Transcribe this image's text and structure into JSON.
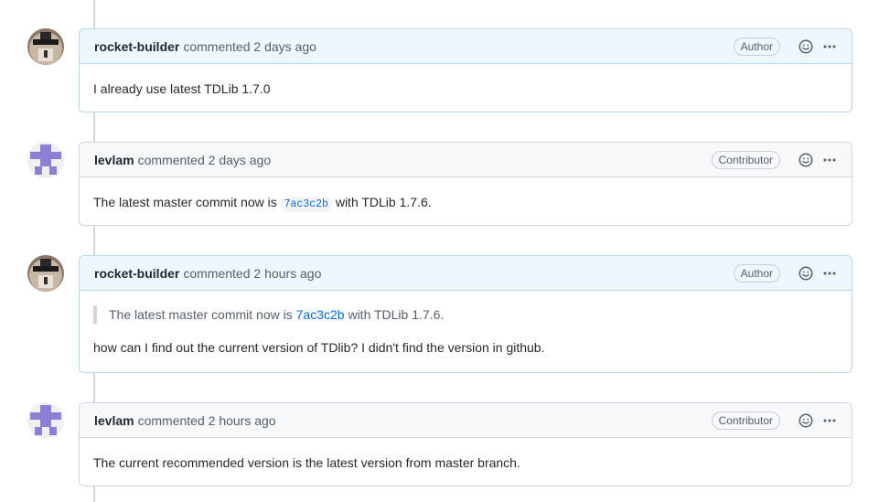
{
  "comments": [
    {
      "username": "rocket-builder",
      "action": "commented",
      "time": "2 days ago",
      "role": "Author",
      "body": "I already use latest TDLib 1.7.0"
    },
    {
      "username": "levlam",
      "action": "commented",
      "time": "2 days ago",
      "role": "Contributor",
      "body_prefix": "The latest master commit now is",
      "body_code": "7ac3c2b",
      "body_suffix": "with TDLib 1.7.6."
    },
    {
      "username": "rocket-builder",
      "action": "commented",
      "time": "2 hours ago",
      "role": "Author",
      "quote_prefix": "The latest master commit now is",
      "quote_link": "7ac3c2b",
      "quote_suffix": "with TDLib 1.7.6.",
      "body": "how can I find out the current version of TDlib? I didn't find the version in github."
    },
    {
      "username": "levlam",
      "action": "commented",
      "time": "2 hours ago",
      "role": "Contributor",
      "body": "The current recommended version is the latest version from master branch."
    }
  ],
  "icons": {
    "reaction": "smiley-icon",
    "menu": "kebab-horizontal-icon"
  },
  "colors": {
    "author_header_bg": "#eef7ff",
    "author_border": "#b6d8f6",
    "contributor_header_bg": "#f6f8fa",
    "link": "#0969da",
    "identicon": "#8b7fd6"
  }
}
